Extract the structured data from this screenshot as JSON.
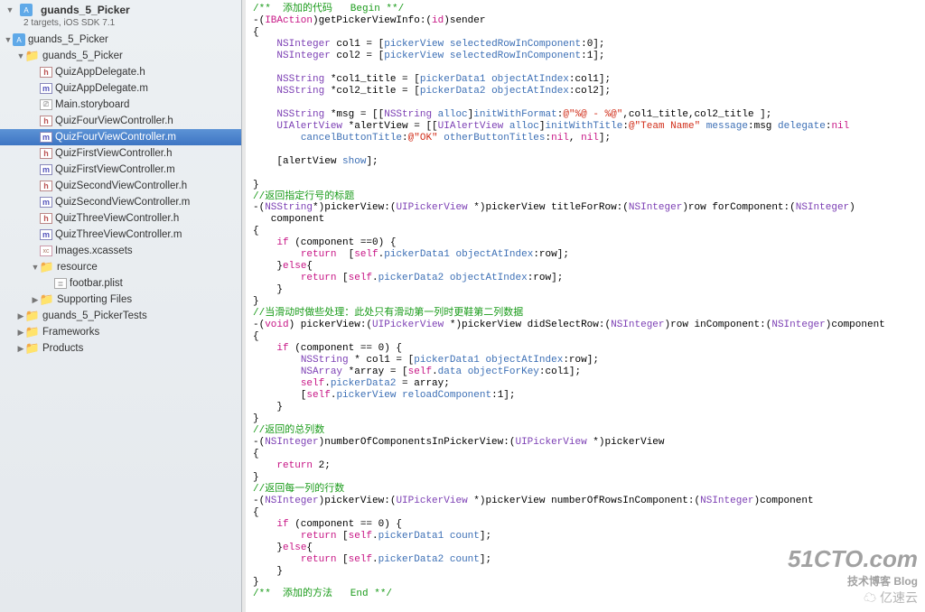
{
  "project": {
    "title": "guands_5_Picker",
    "subtitle": "2 targets, iOS SDK 7.1"
  },
  "tree": [
    {
      "ind": 0,
      "disc": "▼",
      "icon": "proj",
      "label": "guands_5_Picker",
      "sel": false,
      "interact": true
    },
    {
      "ind": 1,
      "disc": "▼",
      "icon": "folder",
      "label": "guands_5_Picker",
      "sel": false,
      "interact": true
    },
    {
      "ind": 2,
      "disc": "",
      "icon": "h",
      "label": "QuizAppDelegate.h",
      "sel": false,
      "interact": true
    },
    {
      "ind": 2,
      "disc": "",
      "icon": "m",
      "label": "QuizAppDelegate.m",
      "sel": false,
      "interact": true
    },
    {
      "ind": 2,
      "disc": "",
      "icon": "sb",
      "label": "Main.storyboard",
      "sel": false,
      "interact": true
    },
    {
      "ind": 2,
      "disc": "",
      "icon": "h",
      "label": "QuizFourViewController.h",
      "sel": false,
      "interact": true
    },
    {
      "ind": 2,
      "disc": "",
      "icon": "m",
      "label": "QuizFourViewController.m",
      "sel": true,
      "interact": true
    },
    {
      "ind": 2,
      "disc": "",
      "icon": "h",
      "label": "QuizFirstViewController.h",
      "sel": false,
      "interact": true
    },
    {
      "ind": 2,
      "disc": "",
      "icon": "m",
      "label": "QuizFirstViewController.m",
      "sel": false,
      "interact": true
    },
    {
      "ind": 2,
      "disc": "",
      "icon": "h",
      "label": "QuizSecondViewController.h",
      "sel": false,
      "interact": true
    },
    {
      "ind": 2,
      "disc": "",
      "icon": "m",
      "label": "QuizSecondViewController.m",
      "sel": false,
      "interact": true
    },
    {
      "ind": 2,
      "disc": "",
      "icon": "h",
      "label": "QuizThreeViewController.h",
      "sel": false,
      "interact": true
    },
    {
      "ind": 2,
      "disc": "",
      "icon": "m",
      "label": "QuizThreeViewController.m",
      "sel": false,
      "interact": true
    },
    {
      "ind": 2,
      "disc": "",
      "icon": "xc",
      "label": "Images.xcassets",
      "sel": false,
      "interact": true
    },
    {
      "ind": 2,
      "disc": "▼",
      "icon": "folder",
      "label": "resource",
      "sel": false,
      "interact": true
    },
    {
      "ind": 3,
      "disc": "",
      "icon": "plist",
      "label": "footbar.plist",
      "sel": false,
      "interact": true
    },
    {
      "ind": 2,
      "disc": "▶",
      "icon": "folder",
      "label": "Supporting Files",
      "sel": false,
      "interact": true
    },
    {
      "ind": 1,
      "disc": "▶",
      "icon": "folder",
      "label": "guands_5_PickerTests",
      "sel": false,
      "interact": true
    },
    {
      "ind": 1,
      "disc": "▶",
      "icon": "folder",
      "label": "Frameworks",
      "sel": false,
      "interact": true
    },
    {
      "ind": 1,
      "disc": "▶",
      "icon": "folder",
      "label": "Products",
      "sel": false,
      "interact": true
    }
  ],
  "code_lines": [
    [
      [
        "c-comment",
        "/**  添加的代码   Begin **/"
      ]
    ],
    [
      [
        "",
        "-("
      ],
      [
        "c-keyword",
        "IBAction"
      ],
      [
        "",
        ")getPickerViewInfo:("
      ],
      [
        "c-keyword",
        "id"
      ],
      [
        "",
        ")sender"
      ]
    ],
    [
      [
        "",
        "{"
      ]
    ],
    [
      [
        "",
        "    "
      ],
      [
        "c-type",
        "NSInteger"
      ],
      [
        "",
        " col1 = ["
      ],
      [
        "c-prop",
        "pickerView"
      ],
      [
        "",
        " "
      ],
      [
        "c-method",
        "selectedRowInComponent"
      ],
      [
        "",
        ":"
      ],
      [
        "",
        "0];"
      ]
    ],
    [
      [
        "",
        "    "
      ],
      [
        "c-type",
        "NSInteger"
      ],
      [
        "",
        " col2 = ["
      ],
      [
        "c-prop",
        "pickerView"
      ],
      [
        "",
        " "
      ],
      [
        "c-method",
        "selectedRowInComponent"
      ],
      [
        "",
        ":"
      ],
      [
        "",
        "1];"
      ]
    ],
    [
      [
        "",
        ""
      ]
    ],
    [
      [
        "",
        "    "
      ],
      [
        "c-type",
        "NSString"
      ],
      [
        "",
        " *col1_title = ["
      ],
      [
        "c-prop",
        "pickerData1"
      ],
      [
        "",
        " "
      ],
      [
        "c-method",
        "objectAtIndex"
      ],
      [
        "",
        ":col1];"
      ]
    ],
    [
      [
        "",
        "    "
      ],
      [
        "c-type",
        "NSString"
      ],
      [
        "",
        " *col2_title = ["
      ],
      [
        "c-prop",
        "pickerData2"
      ],
      [
        "",
        " "
      ],
      [
        "c-method",
        "objectAtIndex"
      ],
      [
        "",
        ":col2];"
      ]
    ],
    [
      [
        "",
        ""
      ]
    ],
    [
      [
        "",
        "    "
      ],
      [
        "c-type",
        "NSString"
      ],
      [
        "",
        " *msg = [["
      ],
      [
        "c-type",
        "NSString"
      ],
      [
        "",
        " "
      ],
      [
        "c-method",
        "alloc"
      ],
      [
        "",
        "]"
      ],
      [
        "c-method",
        "initWithFormat"
      ],
      [
        "",
        ":"
      ],
      [
        "c-string",
        "@\"%@ - %@\""
      ],
      [
        "",
        ",col1_title,col2_title ];"
      ]
    ],
    [
      [
        "",
        "    "
      ],
      [
        "c-type",
        "UIAlertView"
      ],
      [
        "",
        " *alertView = [["
      ],
      [
        "c-type",
        "UIAlertView"
      ],
      [
        "",
        " "
      ],
      [
        "c-method",
        "alloc"
      ],
      [
        "",
        "]"
      ],
      [
        "c-method",
        "initWithTitle"
      ],
      [
        "",
        ":"
      ],
      [
        "c-string",
        "@\"Team Name\""
      ],
      [
        "",
        " "
      ],
      [
        "c-method",
        "message"
      ],
      [
        "",
        ":msg "
      ],
      [
        "c-method",
        "delegate"
      ],
      [
        "",
        ":"
      ],
      [
        "c-keyword",
        "nil"
      ]
    ],
    [
      [
        "",
        "        "
      ],
      [
        "c-method",
        "cancelButtonTitle"
      ],
      [
        "",
        ":"
      ],
      [
        "c-string",
        "@\"OK\""
      ],
      [
        "",
        " "
      ],
      [
        "c-method",
        "otherButtonTitles"
      ],
      [
        "",
        ":"
      ],
      [
        "c-keyword",
        "nil"
      ],
      [
        "",
        ", "
      ],
      [
        "c-keyword",
        "nil"
      ],
      [
        "",
        "];"
      ]
    ],
    [
      [
        "",
        ""
      ]
    ],
    [
      [
        "",
        "    [alertView "
      ],
      [
        "c-method",
        "show"
      ],
      [
        "",
        "];"
      ]
    ],
    [
      [
        "",
        ""
      ]
    ],
    [
      [
        "",
        "}"
      ]
    ],
    [
      [
        "c-comment",
        "//返回指定行号的标题"
      ]
    ],
    [
      [
        "",
        "-("
      ],
      [
        "c-type",
        "NSString"
      ],
      [
        "",
        "*)pickerView:("
      ],
      [
        "c-type",
        "UIPickerView"
      ],
      [
        "",
        " *)pickerView titleForRow:("
      ],
      [
        "c-type",
        "NSInteger"
      ],
      [
        "",
        ")row forComponent:("
      ],
      [
        "c-type",
        "NSInteger"
      ],
      [
        "",
        ")"
      ]
    ],
    [
      [
        "",
        "   component"
      ]
    ],
    [
      [
        "",
        "{"
      ]
    ],
    [
      [
        "",
        "    "
      ],
      [
        "c-keyword",
        "if"
      ],
      [
        "",
        " (component ==0) {"
      ]
    ],
    [
      [
        "",
        "        "
      ],
      [
        "c-keyword",
        "return"
      ],
      [
        "",
        "  ["
      ],
      [
        "c-keyword",
        "self"
      ],
      [
        "",
        "."
      ],
      [
        "c-prop",
        "pickerData1"
      ],
      [
        "",
        " "
      ],
      [
        "c-method",
        "objectAtIndex"
      ],
      [
        "",
        ":row];"
      ]
    ],
    [
      [
        "",
        "    }"
      ],
      [
        "c-keyword",
        "else"
      ],
      [
        "",
        "{"
      ]
    ],
    [
      [
        "",
        "        "
      ],
      [
        "c-keyword",
        "return"
      ],
      [
        "",
        " ["
      ],
      [
        "c-keyword",
        "self"
      ],
      [
        "",
        "."
      ],
      [
        "c-prop",
        "pickerData2"
      ],
      [
        "",
        " "
      ],
      [
        "c-method",
        "objectAtIndex"
      ],
      [
        "",
        ":row];"
      ]
    ],
    [
      [
        "",
        "    }"
      ]
    ],
    [
      [
        "",
        "}"
      ]
    ],
    [
      [
        "c-comment",
        "//当滑动时做些处理：此处只有滑动第一列时更鞋第二列数据"
      ]
    ],
    [
      [
        "",
        "-("
      ],
      [
        "c-keyword",
        "void"
      ],
      [
        "",
        ") pickerView:("
      ],
      [
        "c-type",
        "UIPickerView"
      ],
      [
        "",
        " *)pickerView didSelectRow:("
      ],
      [
        "c-type",
        "NSInteger"
      ],
      [
        "",
        ")row inComponent:("
      ],
      [
        "c-type",
        "NSInteger"
      ],
      [
        "",
        ")component"
      ]
    ],
    [
      [
        "",
        "{"
      ]
    ],
    [
      [
        "",
        "    "
      ],
      [
        "c-keyword",
        "if"
      ],
      [
        "",
        " (component == 0) {"
      ]
    ],
    [
      [
        "",
        "        "
      ],
      [
        "c-type",
        "NSString"
      ],
      [
        "",
        " * col1 = ["
      ],
      [
        "c-prop",
        "pickerData1"
      ],
      [
        "",
        " "
      ],
      [
        "c-method",
        "objectAtIndex"
      ],
      [
        "",
        ":row];"
      ]
    ],
    [
      [
        "",
        "        "
      ],
      [
        "c-type",
        "NSArray"
      ],
      [
        "",
        " *array = ["
      ],
      [
        "c-keyword",
        "self"
      ],
      [
        "",
        "."
      ],
      [
        "c-prop",
        "data"
      ],
      [
        "",
        " "
      ],
      [
        "c-method",
        "objectForKey"
      ],
      [
        "",
        ":col1];"
      ]
    ],
    [
      [
        "",
        "        "
      ],
      [
        "c-keyword",
        "self"
      ],
      [
        "",
        "."
      ],
      [
        "c-prop",
        "pickerData2"
      ],
      [
        "",
        " = array;"
      ]
    ],
    [
      [
        "",
        "        ["
      ],
      [
        "c-keyword",
        "self"
      ],
      [
        "",
        "."
      ],
      [
        "c-prop",
        "pickerView"
      ],
      [
        "",
        " "
      ],
      [
        "c-method",
        "reloadComponent"
      ],
      [
        "",
        ":1];"
      ]
    ],
    [
      [
        "",
        "    }"
      ]
    ],
    [
      [
        "",
        "}"
      ]
    ],
    [
      [
        "c-comment",
        "//返回的总列数"
      ]
    ],
    [
      [
        "",
        "-("
      ],
      [
        "c-type",
        "NSInteger"
      ],
      [
        "",
        ")numberOfComponentsInPickerView:("
      ],
      [
        "c-type",
        "UIPickerView"
      ],
      [
        "",
        " *)pickerView"
      ]
    ],
    [
      [
        "",
        "{"
      ]
    ],
    [
      [
        "",
        "    "
      ],
      [
        "c-keyword",
        "return"
      ],
      [
        "",
        " 2;"
      ]
    ],
    [
      [
        "",
        "}"
      ]
    ],
    [
      [
        "c-comment",
        "//返回每一列的行数"
      ]
    ],
    [
      [
        "",
        "-("
      ],
      [
        "c-type",
        "NSInteger"
      ],
      [
        "",
        ")pickerView:("
      ],
      [
        "c-type",
        "UIPickerView"
      ],
      [
        "",
        " *)pickerView numberOfRowsInComponent:("
      ],
      [
        "c-type",
        "NSInteger"
      ],
      [
        "",
        ")component"
      ]
    ],
    [
      [
        "",
        "{"
      ]
    ],
    [
      [
        "",
        "    "
      ],
      [
        "c-keyword",
        "if"
      ],
      [
        "",
        " (component == 0) {"
      ]
    ],
    [
      [
        "",
        "        "
      ],
      [
        "c-keyword",
        "return"
      ],
      [
        "",
        " ["
      ],
      [
        "c-keyword",
        "self"
      ],
      [
        "",
        "."
      ],
      [
        "c-prop",
        "pickerData1"
      ],
      [
        "",
        " "
      ],
      [
        "c-method",
        "count"
      ],
      [
        "",
        "];"
      ]
    ],
    [
      [
        "",
        "    }"
      ],
      [
        "c-keyword",
        "else"
      ],
      [
        "",
        "{"
      ]
    ],
    [
      [
        "",
        "        "
      ],
      [
        "c-keyword",
        "return"
      ],
      [
        "",
        " ["
      ],
      [
        "c-keyword",
        "self"
      ],
      [
        "",
        "."
      ],
      [
        "c-prop",
        "pickerData2"
      ],
      [
        "",
        " "
      ],
      [
        "c-method",
        "count"
      ],
      [
        "",
        "];"
      ]
    ],
    [
      [
        "",
        "    }"
      ]
    ],
    [
      [
        "",
        "}"
      ]
    ],
    [
      [
        "c-comment",
        "/**  添加的方法   End **/"
      ]
    ]
  ],
  "watermark": {
    "top": "51CTO.com",
    "mid": "技术博客   Blog",
    "bot": "亿速云"
  },
  "icon_labels": {
    "proj": "A",
    "folder": "📁",
    "h": "h",
    "m": "m",
    "sb": "⎚",
    "xc": "xc",
    "plist": "≣"
  }
}
